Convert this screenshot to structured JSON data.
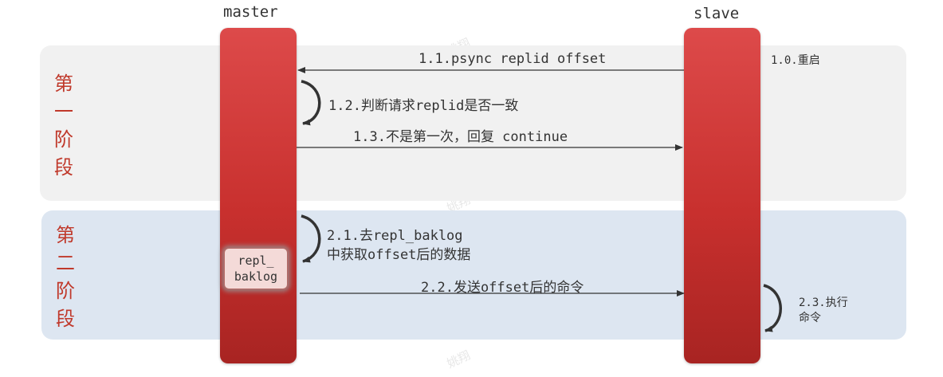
{
  "lanes": {
    "master": "master",
    "slave": "slave"
  },
  "phases": [
    {
      "chars": [
        "第",
        "一",
        "阶",
        "段"
      ]
    },
    {
      "chars": [
        "第",
        "二",
        "阶",
        "段"
      ]
    }
  ],
  "backlog": {
    "line1": "repl_",
    "line2": "baklog"
  },
  "steps": {
    "s1_0": "1.0.重启",
    "s1_1": "1.1.psync replid offset",
    "s1_2": "1.2.判断请求replid是否一致",
    "s1_3": "1.3.不是第一次，回复 continue",
    "s2_1_line1": "2.1.去repl_baklog",
    "s2_1_line2": "中获取offset后的数据",
    "s2_2": "2.2.发送offset后的命令",
    "s2_3_line1": "2.3.执行",
    "s2_3_line2": "命令"
  },
  "watermark": "姚翔",
  "colors": {
    "lifeline": "#c8302e",
    "phase_label": "#c0392b",
    "band_1": "#f1f1f1",
    "band_2": "#dde6f1"
  }
}
